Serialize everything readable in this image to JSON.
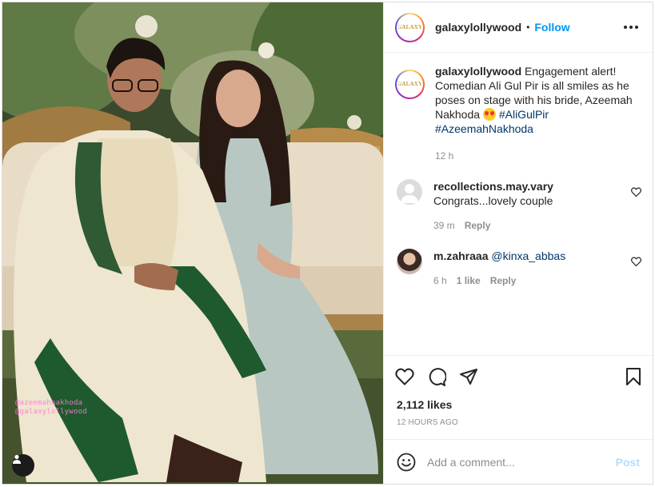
{
  "post": {
    "username": "galaxylollywood",
    "follow_label": "Follow",
    "avatar_logo_text": "GALAXY",
    "caption": {
      "username": "galaxylollywood",
      "text": "Engagement alert! Comedian Ali Gul Pir is all smiles as he poses on stage with his bride, Azeemah Nakhoda",
      "hashtag1": "#AliGulPir",
      "hashtag2": "#AzeemahNakhoda",
      "time": "12 h"
    },
    "comments": [
      {
        "username": "recollections.may.vary",
        "text": "Congrats...lovely couple",
        "time": "39 m",
        "reply_label": "Reply"
      },
      {
        "username": "m.zahraaa",
        "mention": "@kinxa_abbas",
        "time": "6 h",
        "likes": "1 like",
        "reply_label": "Reply"
      }
    ],
    "likes": "2,112 likes",
    "timestamp": "12 HOURS AGO",
    "add_comment_placeholder": "Add a comment...",
    "post_label": "Post"
  },
  "photo": {
    "watermark_line1": "@azeemahnakhoda",
    "watermark_line2": "@galaxylollywood"
  },
  "colors": {
    "accent": "#0095f6",
    "hashtag": "#00376b",
    "muted": "#8e8e8e",
    "post_disabled": "#b2dffc"
  },
  "icons": [
    "user-tag-icon",
    "more-options-icon",
    "heart-icon",
    "comment-icon",
    "share-icon",
    "bookmark-icon",
    "emoji-icon"
  ]
}
